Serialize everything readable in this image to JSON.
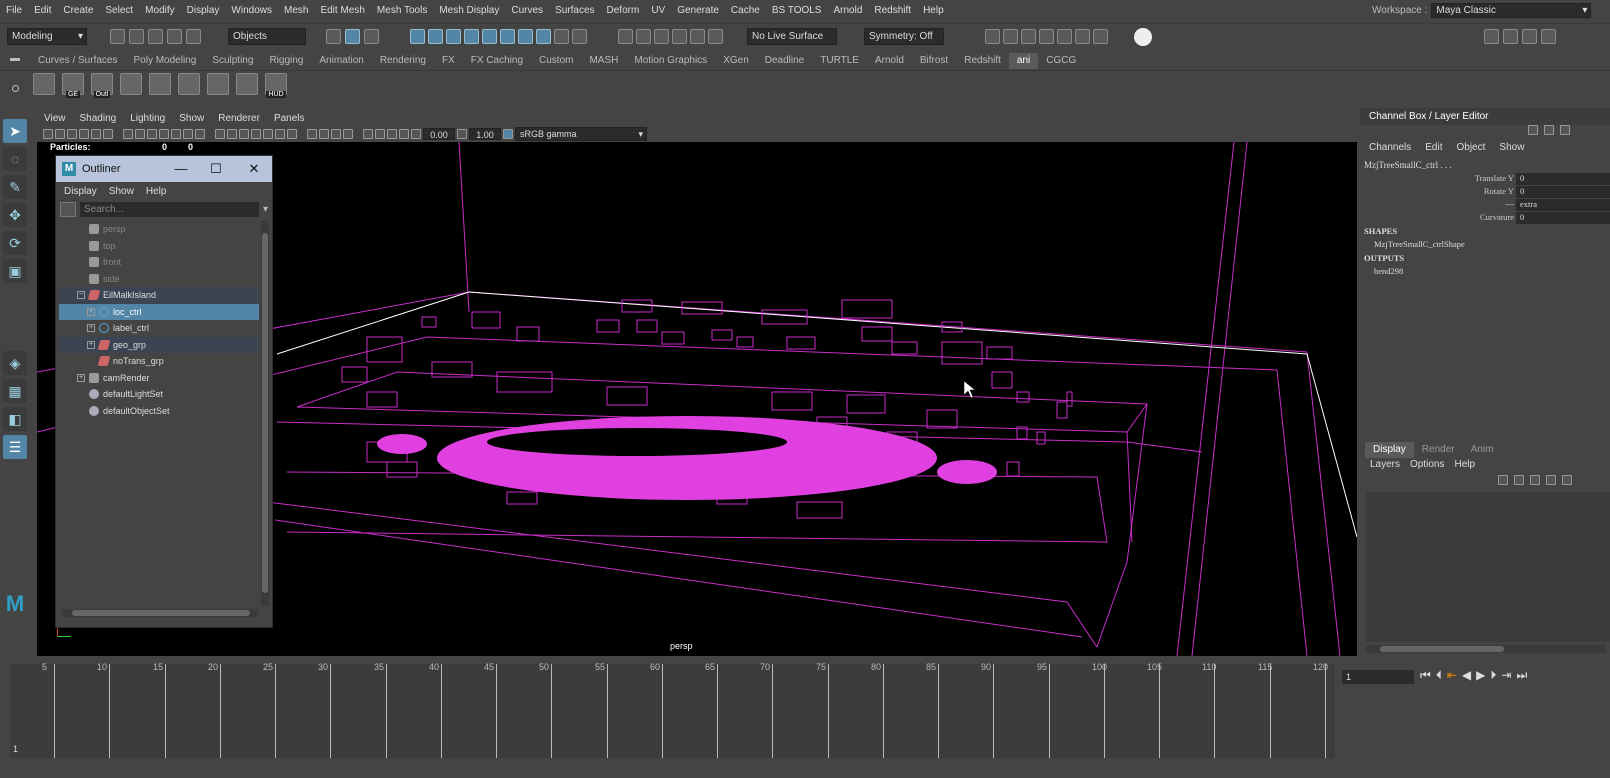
{
  "menu": [
    "File",
    "Edit",
    "Create",
    "Select",
    "Modify",
    "Display",
    "Windows",
    "Mesh",
    "Edit Mesh",
    "Mesh Tools",
    "Mesh Display",
    "Curves",
    "Surfaces",
    "Deform",
    "UV",
    "Generate",
    "Cache",
    "BS TOOLS",
    "Arnold",
    "Redshift",
    "Help"
  ],
  "workspace": {
    "label": "Workspace :",
    "value": "Maya Classic"
  },
  "status": {
    "mode": "Modeling",
    "selection_mask": "Objects",
    "live_surface": "No Live Surface",
    "symmetry": "Symmetry: Off"
  },
  "shelf_tabs": [
    "Curves / Surfaces",
    "Poly Modeling",
    "Sculpting",
    "Rigging",
    "Animation",
    "Rendering",
    "FX",
    "FX Caching",
    "Custom",
    "MASH",
    "Motion Graphics",
    "XGen",
    "Deadline",
    "TURTLE",
    "Arnold",
    "Bifrost",
    "Redshift",
    "ani",
    "CGCG"
  ],
  "shelf_active": "ani",
  "shelf_icons": [
    {
      "name": "poly-cube-icon",
      "label": ""
    },
    {
      "name": "graph-editor-icon",
      "label": "GE"
    },
    {
      "name": "outliner-icon",
      "label": "Outl"
    },
    {
      "name": "joint-tool-icon",
      "label": ""
    },
    {
      "name": "ik-handle-icon",
      "label": ""
    },
    {
      "name": "ik-spline-icon",
      "label": ""
    },
    {
      "name": "locator-icon",
      "label": ""
    },
    {
      "name": "constraint-icon",
      "label": ""
    },
    {
      "name": "hud-icon",
      "label": "HUD"
    }
  ],
  "panel_menu": [
    "View",
    "Shading",
    "Lighting",
    "Show",
    "Renderer",
    "Panels"
  ],
  "panel_toolbar": {
    "exposure": "0.00",
    "gamma": "1.00",
    "color_space": "sRGB gamma"
  },
  "hud": {
    "label": "Particles:",
    "v1": "0",
    "v2": "0"
  },
  "camera_label": "persp",
  "outliner": {
    "title": "Outliner",
    "menu": [
      "Display",
      "Show",
      "Help"
    ],
    "search_placeholder": "Search...",
    "items": [
      {
        "label": "persp",
        "indent": 1,
        "type": "camera",
        "state": "dim",
        "expand": ""
      },
      {
        "label": "top",
        "indent": 1,
        "type": "camera",
        "state": "dim",
        "expand": ""
      },
      {
        "label": "front",
        "indent": 1,
        "type": "camera",
        "state": "dim",
        "expand": ""
      },
      {
        "label": "side",
        "indent": 1,
        "type": "camera",
        "state": "dim",
        "expand": ""
      },
      {
        "label": "EilMalkIsland",
        "indent": 1,
        "type": "group",
        "state": "hl",
        "expand": "−"
      },
      {
        "label": "loc_ctrl",
        "indent": 2,
        "type": "curve",
        "state": "sel",
        "expand": "+"
      },
      {
        "label": "label_ctrl",
        "indent": 2,
        "type": "curve",
        "state": "",
        "expand": "+"
      },
      {
        "label": "geo_grp",
        "indent": 2,
        "type": "group",
        "state": "hl",
        "expand": "+"
      },
      {
        "label": "noTrans_grp",
        "indent": 2,
        "type": "group",
        "state": "",
        "expand": ""
      },
      {
        "label": "camRender",
        "indent": 1,
        "type": "camera",
        "state": "",
        "expand": "+"
      },
      {
        "label": "defaultLightSet",
        "indent": 1,
        "type": "set",
        "state": "",
        "expand": ""
      },
      {
        "label": "defaultObjectSet",
        "indent": 1,
        "type": "set",
        "state": "",
        "expand": ""
      }
    ]
  },
  "channel_box": {
    "title": "Channel Box / Layer Editor",
    "menu": [
      "Channels",
      "Edit",
      "Object",
      "Show"
    ],
    "object": "MzjTreeSmallC_ctrl . . .",
    "attrs": [
      {
        "name": "Translate Y",
        "value": "0"
      },
      {
        "name": "Rotate Y",
        "value": "0"
      },
      {
        "name": "---",
        "value": "extra"
      },
      {
        "name": "Curvature",
        "value": "0"
      }
    ],
    "shapes_header": "SHAPES",
    "shape": "MzjTreeSmallC_ctrlShape",
    "outputs_header": "OUTPUTS",
    "output": "bend298"
  },
  "layer_editor": {
    "tabs": [
      "Display",
      "Render",
      "Anim"
    ],
    "active": "Display",
    "menu": [
      "Layers",
      "Options",
      "Help"
    ]
  },
  "timeline": {
    "start": 1,
    "end": 120,
    "labels": [
      5,
      10,
      15,
      20,
      25,
      30,
      35,
      40,
      45,
      50,
      55,
      60,
      65,
      70,
      75,
      80,
      85,
      90,
      95,
      100,
      105,
      110,
      115,
      120
    ],
    "current_frame": "1",
    "frame_marker": "1"
  },
  "colors": {
    "accent": "#5285a6",
    "wire": "#c82cc8",
    "outliner_title": "#b8c4dc"
  }
}
